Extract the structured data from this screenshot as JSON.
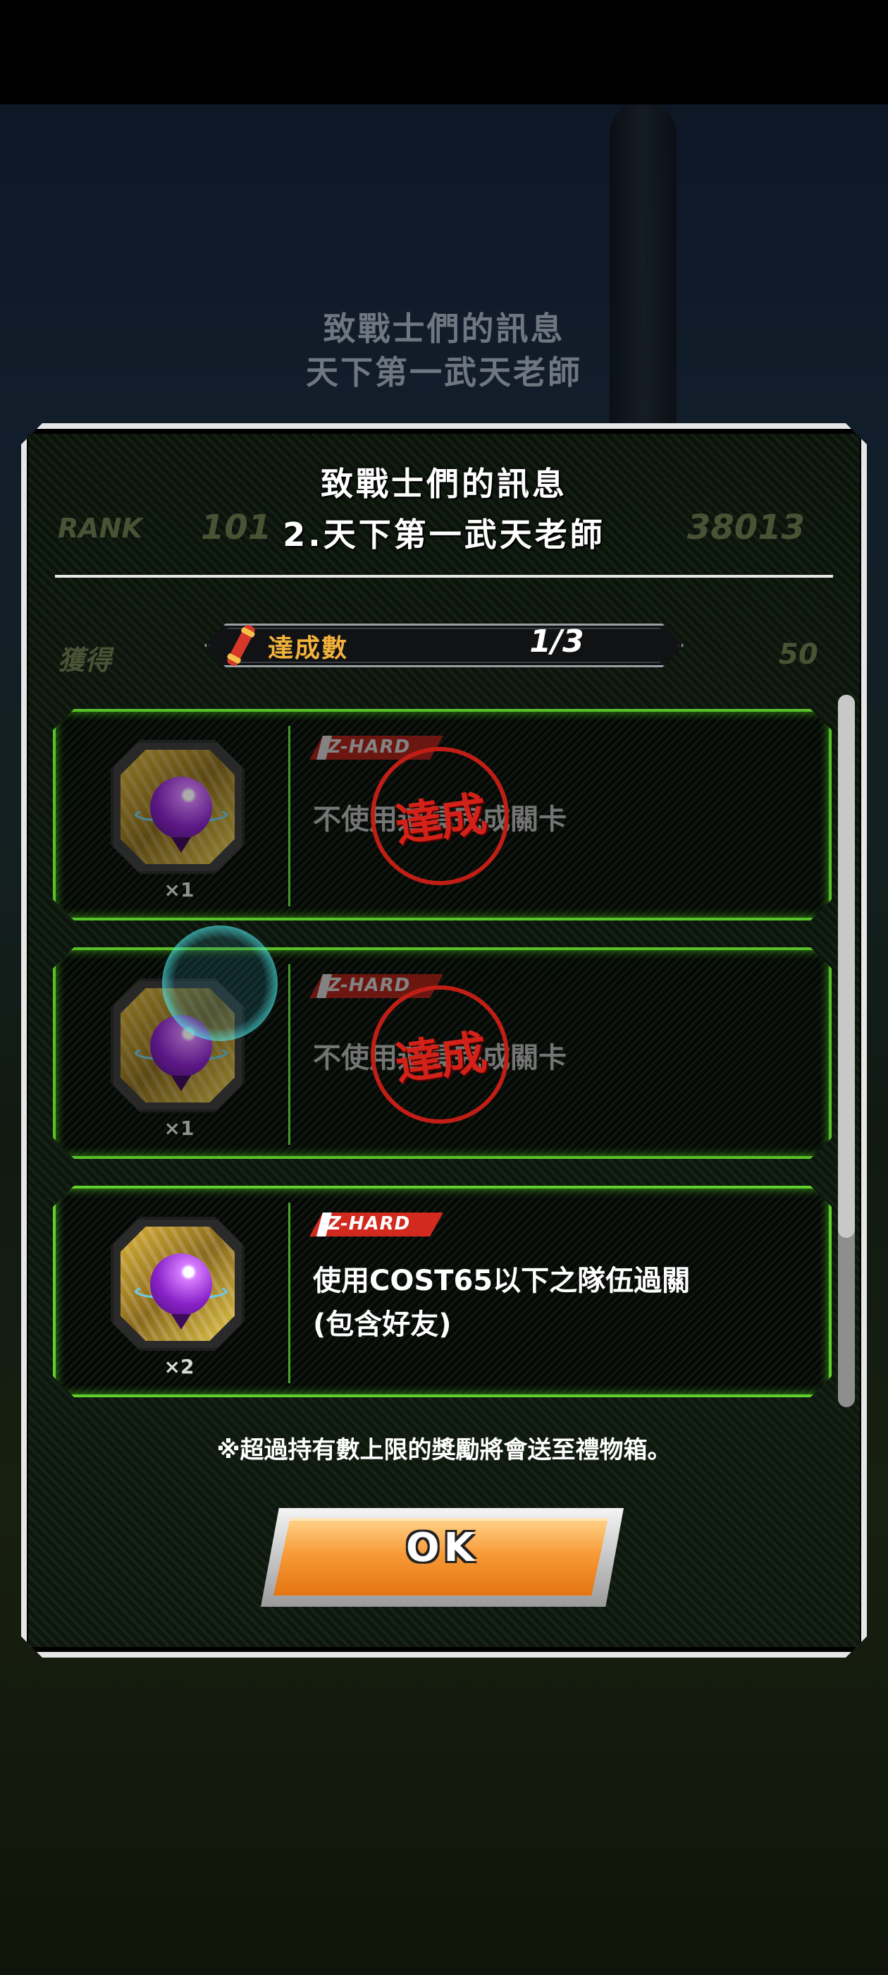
{
  "background": {
    "title_line1": "致戰士們的訊息",
    "title_line2": "天下第一武天老師",
    "difficulty": "Z-HARD",
    "rank_label": "RANK",
    "rank_value": "101",
    "score": "38013",
    "obtained_label": "獲得",
    "obtained_value": "50"
  },
  "modal": {
    "title_line1": "致戰士們的訊息",
    "title_line2": "2.天下第一武天老師",
    "progress_label": "達成數",
    "progress_value": "1/3",
    "progress_fraction": 0.333,
    "note": "※超過持有數上限的獎勵將會送至禮物箱。",
    "ok_label": "OK"
  },
  "missions": [
    {
      "difficulty": "Z-HARD",
      "text": "不使用道具完成關卡",
      "quantity": "×1",
      "stamp": "達成",
      "completed": true,
      "reward_icon": "purple-orb-icon"
    },
    {
      "difficulty": "Z-HARD",
      "text": "不使用道具完成關卡",
      "quantity": "×1",
      "stamp": "達成",
      "completed": true,
      "reward_icon": "purple-orb-icon"
    },
    {
      "difficulty": "Z-HARD",
      "text_line1": "使用COST65以下之隊伍過關",
      "text_line2": "(包含好友)",
      "quantity": "×2",
      "completed": false,
      "reward_icon": "purple-orb-icon"
    }
  ],
  "colors": {
    "card_border": "#5fd02c",
    "stamp": "#e3231a",
    "zhard_badge": "#d22a1f",
    "ok_button": "#f79a36",
    "progress_label": "#f3b23c"
  }
}
